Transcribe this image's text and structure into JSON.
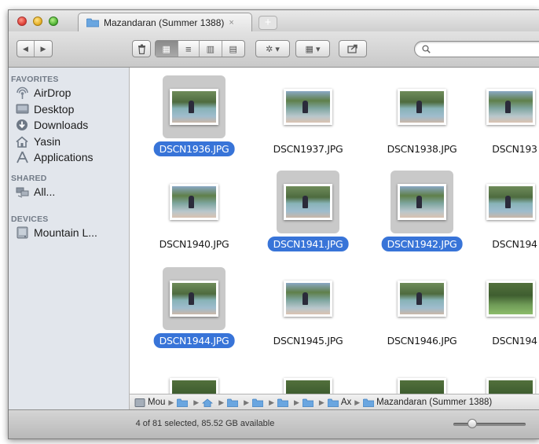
{
  "tab": {
    "title": "Mazandaran (Summer 1388)",
    "close_glyph": "×"
  },
  "new_tab_glyph": "+",
  "toolbar": {
    "back_glyph": "◀",
    "forward_glyph": "▶",
    "view_icon_glyph": "▦",
    "view_list_glyph": "≡",
    "view_columns_glyph": "▥",
    "view_coverflow_glyph": "▤",
    "action_glyph": "✲ ▾",
    "arrange_glyph": "▦ ▾",
    "search": {
      "value": "",
      "placeholder": ""
    }
  },
  "sidebar": {
    "favorites_header": "FAVORITES",
    "favorites": [
      {
        "label": "AirDrop",
        "icon": "airdrop-icon"
      },
      {
        "label": "Desktop",
        "icon": "desktop-icon"
      },
      {
        "label": "Downloads",
        "icon": "downloads-icon"
      },
      {
        "label": "Yasin",
        "icon": "home-icon"
      },
      {
        "label": "Applications",
        "icon": "applications-icon"
      }
    ],
    "shared_header": "SHARED",
    "shared": [
      {
        "label": "All...",
        "icon": "network-icon"
      }
    ],
    "devices_header": "DEVICES",
    "devices": [
      {
        "label": "Mountain L...",
        "icon": "hard-drive-icon"
      }
    ]
  },
  "files": [
    {
      "name": "DSCN1936.JPG",
      "selected": true
    },
    {
      "name": "DSCN1937.JPG",
      "selected": false
    },
    {
      "name": "DSCN1938.JPG",
      "selected": false
    },
    {
      "name": "DSCN193",
      "selected": false
    },
    {
      "name": "DSCN1940.JPG",
      "selected": false
    },
    {
      "name": "DSCN1941.JPG",
      "selected": true
    },
    {
      "name": "DSCN1942.JPG",
      "selected": true
    },
    {
      "name": "DSCN194",
      "selected": false
    },
    {
      "name": "DSCN1944.JPG",
      "selected": true
    },
    {
      "name": "DSCN1945.JPG",
      "selected": false
    },
    {
      "name": "DSCN1946.JPG",
      "selected": false
    },
    {
      "name": "DSCN194",
      "selected": false
    }
  ],
  "pathbar": {
    "first": "Mou",
    "ax": "Ax",
    "last": "Mazandaran (Summer 1388)"
  },
  "status": {
    "text": "4 of 81 selected, 85.52 GB available"
  },
  "colors": {
    "selection": "#3874d8",
    "sidebar_bg": "#e2e6ec",
    "folder": "#6aa6e0"
  }
}
